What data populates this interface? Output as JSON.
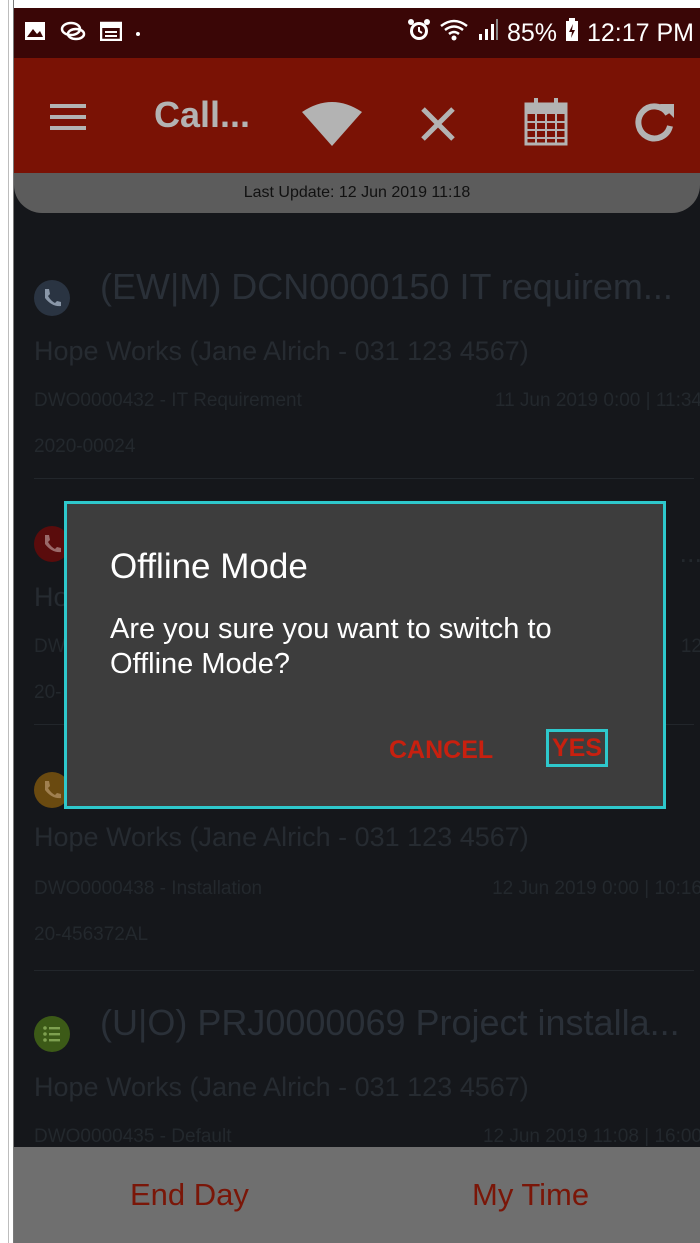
{
  "status_bar": {
    "battery": "85%",
    "time": "12:17 PM",
    "left_icons": [
      "gallery-icon",
      "chat-bubbles-icon",
      "calendar-icon"
    ],
    "right_icons": [
      "alarm-icon",
      "wifi-icon",
      "signal-icon",
      "battery-charging-icon"
    ]
  },
  "app_bar": {
    "title": "Call...",
    "icons": [
      "menu-icon",
      "wifi-off-icon",
      "close-icon",
      "calendar-icon",
      "refresh-icon"
    ],
    "color": "#7a1205"
  },
  "last_update": "Last Update: 12 Jun 2019 11:18",
  "list": [
    {
      "headline": "(EW|M) DCN0000150 IT requirem...",
      "client": "Hope Works (Jane Alrich - 031 123 4567)",
      "ref": "DWO0000432 - IT Requirement",
      "date": "11 Jun 2019 0:00 | 11:34",
      "code": "2020-00024",
      "avatar_color": "#2a3442",
      "icon": "phone-icon"
    },
    {
      "headline": "",
      "client": "Ho",
      "ref": "DW",
      "date": "12",
      "code": "20-",
      "avatar_color": "#5a0c0c",
      "icon": "phone-icon",
      "trailing": "..."
    },
    {
      "headline": "",
      "client": "Hope Works (Jane Alrich - 031 123 4567)",
      "ref": "DWO0000438 - Installation",
      "date": "12 Jun 2019 0:00 | 10:16",
      "code": "20-456372AL",
      "avatar_color": "#6a4a10",
      "icon": "phone-icon"
    },
    {
      "headline": "(U|O) PRJ0000069 Project installa...",
      "client": "Hope Works (Jane Alrich - 031 123 4567)",
      "ref": "DWO0000435 - Default",
      "date": "12 Jun 2019 11:08 | 16:00",
      "code": "",
      "avatar_color": "#3c5a17",
      "icon": "list-icon"
    }
  ],
  "bottom_bar": {
    "end_day": "End Day",
    "my_time": "My Time"
  },
  "dialog": {
    "title": "Offline Mode",
    "message": "Are you sure you want to switch to Offline Mode?",
    "cancel": "CANCEL",
    "yes": "YES"
  }
}
